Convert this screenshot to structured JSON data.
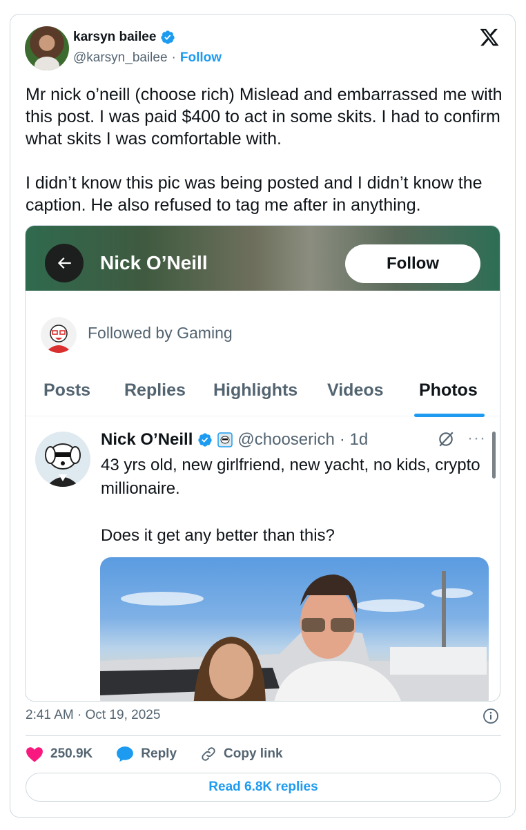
{
  "author": {
    "name": "karsyn bailee",
    "handle": "@karsyn_bailee",
    "separator": "·",
    "follow_label": "Follow"
  },
  "tweet": {
    "paragraphs": [
      "Mr nick o’neill (choose rich) Mislead and embarrassed me with this post. I was paid $400 to act in some skits. I had to confirm what skits I was comfortable with.",
      "I didn’t know this pic was being posted and I didn’t know the caption. He also refused to tag me after in anything."
    ],
    "timestamp": "2:41 AM · Oct 19, 2025"
  },
  "screenshot": {
    "header_title": "Nick O’Neill",
    "follow_button": "Follow",
    "followed_by": "Followed by Gaming",
    "tabs": [
      {
        "label": "Posts",
        "active": false
      },
      {
        "label": "Replies",
        "active": false
      },
      {
        "label": "Highlights",
        "active": false
      },
      {
        "label": "Videos",
        "active": false
      },
      {
        "label": "Photos",
        "active": true
      }
    ],
    "post": {
      "name": "Nick O’Neill",
      "handle": "@chooserich",
      "age": "· 1d",
      "more": "···",
      "text": [
        "43 yrs old, new girlfriend, new yacht, no kids, crypto millionaire.",
        "Does it get any better than this?"
      ]
    }
  },
  "actions": {
    "likes": "250.9K",
    "reply_label": "Reply",
    "copy_link_label": "Copy link"
  },
  "read_replies_label": "Read 6.8K replies",
  "colors": {
    "accent": "#1d9bf0",
    "like": "#f91880",
    "muted_text": "#536471",
    "border": "#cfd9de"
  },
  "icons": [
    "verified-badge-icon",
    "x-logo-icon",
    "back-arrow-icon",
    "grok-icon",
    "more-icon",
    "info-icon",
    "heart-icon",
    "reply-icon",
    "link-icon"
  ]
}
